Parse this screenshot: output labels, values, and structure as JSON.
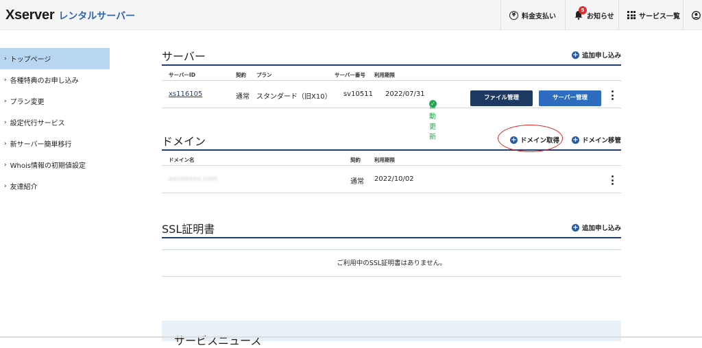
{
  "header": {
    "logo_main": "Xserver",
    "logo_sub": "レンタルサーバー",
    "payment_label": "料金支払い",
    "notice_label": "お知らせ",
    "notice_count": "5",
    "services_label": "サービス一覧"
  },
  "sidebar": {
    "items": [
      {
        "label": "トップページ"
      },
      {
        "label": "各種特典のお申し込み"
      },
      {
        "label": "プラン変更"
      },
      {
        "label": "設定代行サービス"
      },
      {
        "label": "新サーバー簡単移行"
      },
      {
        "label": "Whois情報の初期値設定"
      },
      {
        "label": "友達紹介"
      }
    ]
  },
  "server": {
    "title": "サーバー",
    "add_label": "追加申し込み",
    "columns": [
      "サーバーID",
      "契約",
      "プラン",
      "サーバー番号",
      "利用期限"
    ],
    "row": {
      "id": "xs116105",
      "contract": "通常",
      "plan": "スタンダード（旧X10）",
      "number": "sv10511",
      "expiry": "2022/07/31",
      "auto_renew": "自動更新",
      "file_btn": "ファイル管理",
      "server_btn": "サーバー管理"
    }
  },
  "domain": {
    "title": "ドメイン",
    "acquire_label": "ドメイン取得",
    "transfer_label": "ドメイン移管",
    "columns": [
      "ドメイン名",
      "契約",
      "利用期限"
    ],
    "row": {
      "name": "xxxxxxxx.com",
      "contract": "通常",
      "expiry": "2022/10/02"
    }
  },
  "ssl": {
    "title": "SSL証明書",
    "add_label": "追加申し込み",
    "empty_message": "ご利用中のSSL証明書はありません。"
  },
  "news": {
    "title": "サービスニュース"
  },
  "colors": {
    "accent": "#1f3e6f",
    "link_blue": "#2e6cc0",
    "active_side": "#b8d6f1",
    "renew_green": "#27a652",
    "highlight_red": "#e02424"
  }
}
